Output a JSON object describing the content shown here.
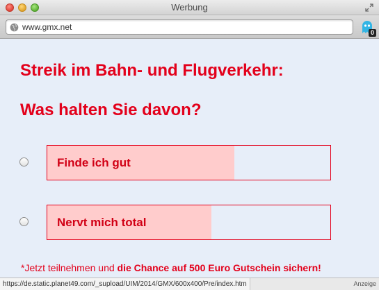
{
  "window": {
    "title": "Werbung"
  },
  "toolbar": {
    "url": "www.gmx.net",
    "extension_badge": "0"
  },
  "poll": {
    "headline_line1": "Streik im Bahn- und Flugverkehr:",
    "headline_line2": "Was halten Sie davon?",
    "options": [
      {
        "label": "Finde ich gut",
        "result_fraction": 0.66
      },
      {
        "label": "Nervt mich total",
        "result_fraction": 0.58
      }
    ],
    "promo_prefix": "*Jetzt teilnehmen und ",
    "promo_bold": "die Chance auf 500 Euro Gutschein sichern!"
  },
  "statusbar": {
    "hover_url": "https://de.static.planet49.com/_supload/UIM/2014/GMX/600x400/Pre/index.htm",
    "ad_label": "Anzeige"
  },
  "colors": {
    "accent": "#e3001b",
    "bar_fill": "#ffcccc",
    "background": "#e7eef9"
  }
}
